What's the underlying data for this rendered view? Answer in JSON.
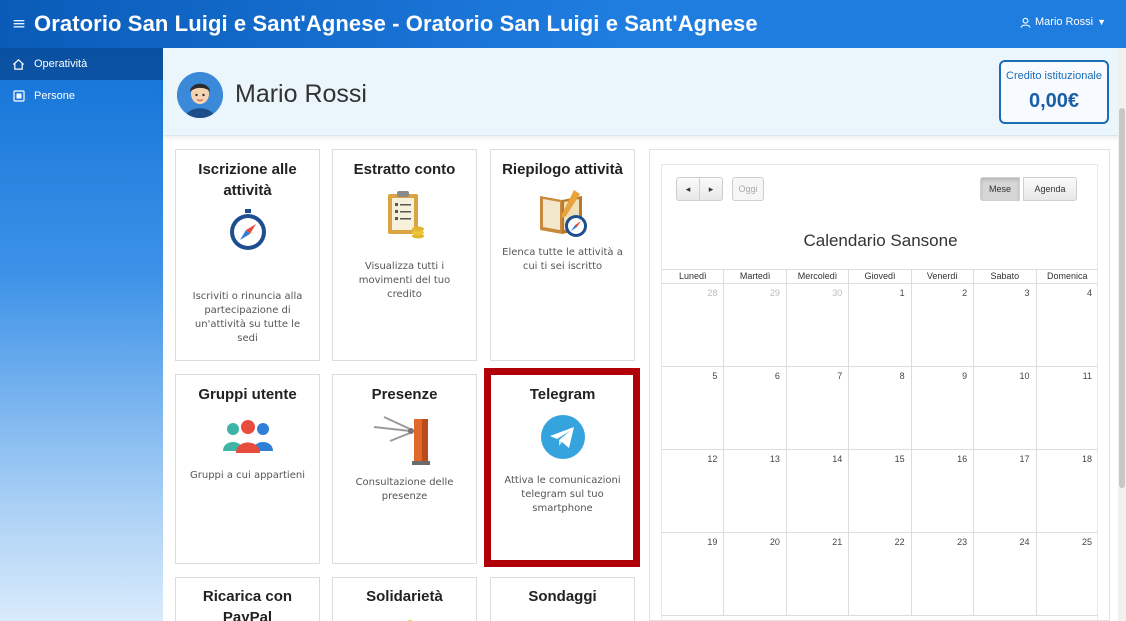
{
  "topbar": {
    "title": "Oratorio San Luigi e Sant'Agnese - Oratorio San Luigi e Sant'Agnese",
    "user": "Mario Rossi"
  },
  "sidebar": {
    "items": [
      {
        "label": "Operatività",
        "icon": "home-icon"
      },
      {
        "label": "Persone",
        "icon": "id-card-icon"
      }
    ]
  },
  "header": {
    "name": "Mario Rossi",
    "credit_label": "Credito istituzionale",
    "credit_value": "0,00€"
  },
  "tiles": [
    {
      "title": "Iscrizione alle attività",
      "desc": "Iscriviti o rinuncia alla partecipazione di un'attività su tutte le sedi",
      "icon": "compass-icon"
    },
    {
      "title": "Estratto conto",
      "desc": "Visualizza tutti i movimenti del tuo credito",
      "icon": "clipboard-coins-icon"
    },
    {
      "title": "Riepilogo attività",
      "desc": "Elenca tutte le attività a cui ti sei iscritto",
      "icon": "book-compass-icon"
    },
    {
      "title": "Gruppi utente",
      "desc": "Gruppi a cui appartieni",
      "icon": "users-group-icon"
    },
    {
      "title": "Presenze",
      "desc": "Consultazione delle presenze",
      "icon": "turnstile-icon"
    },
    {
      "title": "Telegram",
      "desc": "Attiva le comunicazioni telegram sul tuo smartphone",
      "icon": "telegram-icon"
    },
    {
      "title": "Ricarica con PayPal",
      "desc": "",
      "icon": "paypal-icon"
    },
    {
      "title": "Solidarietà",
      "desc": "",
      "icon": "solidarity-icon"
    },
    {
      "title": "Sondaggi",
      "desc": "",
      "icon": "survey-icon"
    }
  ],
  "calendar": {
    "title": "Calendario Sansone",
    "today_label": "Oggi",
    "month_label": "Mese",
    "agenda_label": "Agenda",
    "prev": "◂",
    "next": "▸",
    "weekdays": [
      "Lunedì",
      "Martedì",
      "Mercoledì",
      "Giovedì",
      "Venerdì",
      "Sabato",
      "Domenica"
    ],
    "weeks": [
      [
        "28",
        "29",
        "30",
        "1",
        "2",
        "3",
        "4"
      ],
      [
        "5",
        "6",
        "7",
        "8",
        "9",
        "10",
        "11"
      ],
      [
        "12",
        "13",
        "14",
        "15",
        "16",
        "17",
        "18"
      ],
      [
        "19",
        "20",
        "21",
        "22",
        "23",
        "24",
        "25"
      ]
    ],
    "other_month": [
      [
        0,
        1,
        2
      ]
    ]
  },
  "colors": {
    "topbar": "#1f7de0",
    "highlight": "#b20009",
    "credit_border": "#1a6cb5"
  }
}
